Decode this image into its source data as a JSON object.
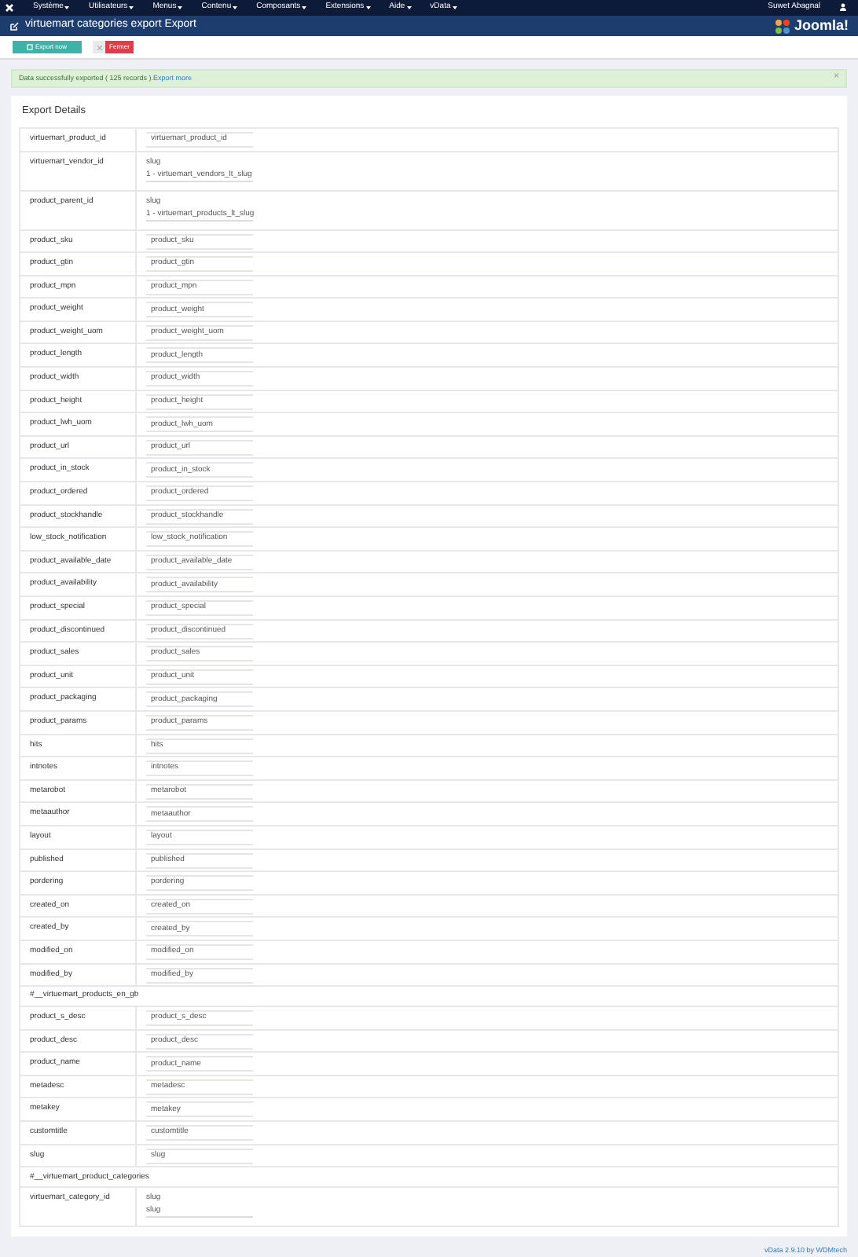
{
  "menu": {
    "items": [
      "Système",
      "Utilisateurs",
      "Menus",
      "Contenu",
      "Composants",
      "Extensions",
      "Aide",
      "vData"
    ],
    "user": "Suwet Abagnal"
  },
  "header": {
    "title": "virtuemart categories export Export",
    "logo": "Joomla!"
  },
  "toolbar": {
    "buttons": [
      {
        "kind": "primary",
        "label": "Export now"
      },
      {
        "kind": "danger",
        "label": "Fermer"
      }
    ]
  },
  "alert": {
    "text": "Data successfully exported ( 125 records ).",
    "link": "Export more",
    "close": "×"
  },
  "panel": {
    "title": "Export Details",
    "rows": [
      {
        "kind": "field",
        "label": "virtuemart_product_id",
        "lines": [
          "virtuemart_product_id"
        ]
      },
      {
        "kind": "field",
        "label": "virtuemart_vendor_id",
        "lines": [
          "slug",
          "1 - virtuemart_vendors_lt_slug"
        ]
      },
      {
        "kind": "field",
        "label": "product_parent_id",
        "lines": [
          "slug",
          "1 - virtuemart_products_lt_slug"
        ]
      },
      {
        "kind": "field",
        "label": "product_sku",
        "lines": [
          "product_sku"
        ]
      },
      {
        "kind": "field",
        "label": "product_gtin",
        "lines": [
          "product_gtin"
        ]
      },
      {
        "kind": "field",
        "label": "product_mpn",
        "lines": [
          "product_mpn"
        ]
      },
      {
        "kind": "field",
        "label": "product_weight",
        "lines": [
          "product_weight"
        ]
      },
      {
        "kind": "field",
        "label": "product_weight_uom",
        "lines": [
          "product_weight_uom"
        ]
      },
      {
        "kind": "field",
        "label": "product_length",
        "lines": [
          "product_length"
        ]
      },
      {
        "kind": "field",
        "label": "product_width",
        "lines": [
          "product_width"
        ]
      },
      {
        "kind": "field",
        "label": "product_height",
        "lines": [
          "product_height"
        ]
      },
      {
        "kind": "field",
        "label": "product_lwh_uom",
        "lines": [
          "product_lwh_uom"
        ]
      },
      {
        "kind": "field",
        "label": "product_url",
        "lines": [
          "product_url"
        ]
      },
      {
        "kind": "field",
        "label": "product_in_stock",
        "lines": [
          "product_in_stock"
        ]
      },
      {
        "kind": "field",
        "label": "product_ordered",
        "lines": [
          "product_ordered"
        ]
      },
      {
        "kind": "field",
        "label": "product_stockhandle",
        "lines": [
          "product_stockhandle"
        ]
      },
      {
        "kind": "field",
        "label": "low_stock_notification",
        "lines": [
          "low_stock_notification"
        ]
      },
      {
        "kind": "field",
        "label": "product_available_date",
        "lines": [
          "product_available_date"
        ]
      },
      {
        "kind": "field",
        "label": "product_availability",
        "lines": [
          "product_availability"
        ]
      },
      {
        "kind": "field",
        "label": "product_special",
        "lines": [
          "product_special"
        ]
      },
      {
        "kind": "field",
        "label": "product_discontinued",
        "lines": [
          "product_discontinued"
        ]
      },
      {
        "kind": "field",
        "label": "product_sales",
        "lines": [
          "product_sales"
        ]
      },
      {
        "kind": "field",
        "label": "product_unit",
        "lines": [
          "product_unit"
        ]
      },
      {
        "kind": "field",
        "label": "product_packaging",
        "lines": [
          "product_packaging"
        ]
      },
      {
        "kind": "field",
        "label": "product_params",
        "lines": [
          "product_params"
        ]
      },
      {
        "kind": "field",
        "label": "hits",
        "lines": [
          "hits"
        ]
      },
      {
        "kind": "field",
        "label": "intnotes",
        "lines": [
          "intnotes"
        ]
      },
      {
        "kind": "field",
        "label": "metarobot",
        "lines": [
          "metarobot"
        ]
      },
      {
        "kind": "field",
        "label": "metaauthor",
        "lines": [
          "metaauthor"
        ]
      },
      {
        "kind": "field",
        "label": "layout",
        "lines": [
          "layout"
        ]
      },
      {
        "kind": "field",
        "label": "published",
        "lines": [
          "published"
        ]
      },
      {
        "kind": "field",
        "label": "pordering",
        "lines": [
          "pordering"
        ]
      },
      {
        "kind": "field",
        "label": "created_on",
        "lines": [
          "created_on"
        ]
      },
      {
        "kind": "field",
        "label": "created_by",
        "lines": [
          "created_by"
        ]
      },
      {
        "kind": "field",
        "label": "modified_on",
        "lines": [
          "modified_on"
        ]
      },
      {
        "kind": "field",
        "label": "modified_by",
        "lines": [
          "modified_by"
        ]
      },
      {
        "kind": "section",
        "label": "#__virtuemart_products_en_gb"
      },
      {
        "kind": "field",
        "label": "product_s_desc",
        "lines": [
          "product_s_desc"
        ]
      },
      {
        "kind": "field",
        "label": "product_desc",
        "lines": [
          "product_desc"
        ]
      },
      {
        "kind": "field",
        "label": "product_name",
        "lines": [
          "product_name"
        ]
      },
      {
        "kind": "field",
        "label": "metadesc",
        "lines": [
          "metadesc"
        ]
      },
      {
        "kind": "field",
        "label": "metakey",
        "lines": [
          "metakey"
        ]
      },
      {
        "kind": "field",
        "label": "customtitle",
        "lines": [
          "customtitle"
        ]
      },
      {
        "kind": "field",
        "label": "slug",
        "lines": [
          "slug"
        ]
      },
      {
        "kind": "section",
        "label": "#__virtuemart_product_categories"
      },
      {
        "kind": "field",
        "label": "virtuemart_category_id",
        "lines": [
          "slug",
          "slug"
        ]
      }
    ]
  },
  "footer": {
    "text": "vData 2.9.10 by WDMtech"
  }
}
